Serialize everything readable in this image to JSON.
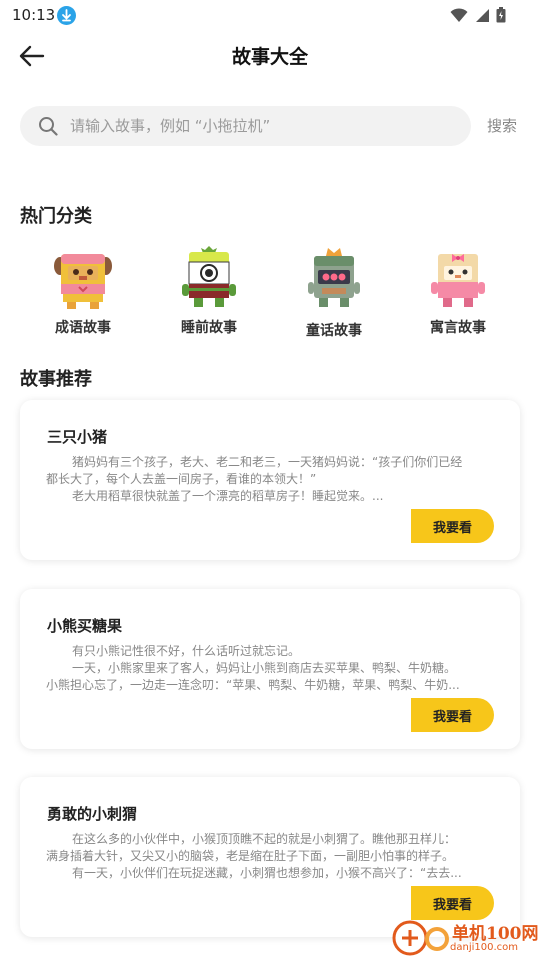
{
  "status_bar": {
    "time": "10:13"
  },
  "header": {
    "title": "故事大全"
  },
  "search": {
    "placeholder": "请输入故事，例如 “小拖拉机”",
    "value": "",
    "button_label": "搜索"
  },
  "categories": {
    "title": "热门分类",
    "items": [
      {
        "label": "成语故事",
        "icon": "pink-brown-cube-character-icon"
      },
      {
        "label": "睡前故事",
        "icon": "green-one-eye-cube-character-icon"
      },
      {
        "label": "童话故事",
        "icon": "grey-crowned-cube-character-icon"
      },
      {
        "label": "寓言故事",
        "icon": "pink-bow-cube-character-icon"
      }
    ]
  },
  "recommend": {
    "title": "故事推荐",
    "button_label": "我要看",
    "stories": [
      {
        "title": "三只小猪",
        "lines": [
          "猪妈妈有三个孩子，老大、老二和老三，一天猪妈妈说：“孩子们你们已经",
          "都长大了，每个人去盖一间房子，看谁的本领大！”",
          "老大用稻草很快就盖了一个漂亮的稻草房子！睡起觉来。..."
        ]
      },
      {
        "title": "小熊买糖果",
        "lines": [
          "有只小熊记性很不好，什么话听过就忘记。",
          "一天，小熊家里来了客人，妈妈让小熊到商店去买苹果、鸭梨、牛奶糖。",
          "小熊担心忘了，一边走一连念叨：“苹果、鸭梨、牛奶糖，苹果、鸭梨、牛奶..."
        ]
      },
      {
        "title": "勇敢的小刺猬",
        "lines": [
          "在这么多的小伙伴中，小猴顶顶瞧不起的就是小刺猬了。瞧他那丑样儿：",
          "满身插着大针，又尖又小的脑袋，老是缩在肚子下面，一副胆小怕事的样子。",
          "有一天，小伙伴们在玩捉迷藏，小刺猬也想参加，小猴不高兴了：“去去..."
        ]
      }
    ]
  },
  "watermark": {
    "title": "单机100网",
    "url": "danji100.com"
  },
  "colors": {
    "accent": "#f7c61a",
    "search_bg": "#f2f2f2",
    "download_badge": "#2aa3e8",
    "watermark": "#e25a1c"
  }
}
